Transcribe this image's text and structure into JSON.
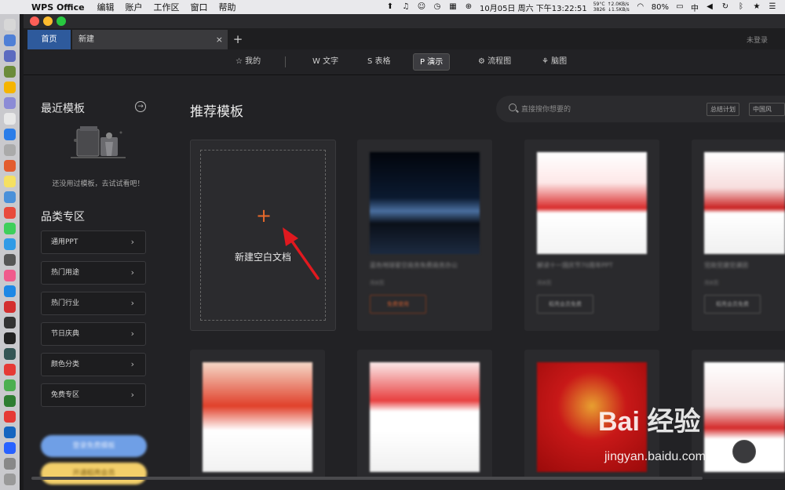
{
  "menubar": {
    "app_name": "WPS Office",
    "menus": [
      "编辑",
      "账户",
      "工作区",
      "窗口",
      "帮助"
    ],
    "temp": "59°C",
    "fan": "3826",
    "net_up": "↑2.0KB/s",
    "net_down": "↓1.5KB/s",
    "datetime": "10月05日 周六 下午13:22:51",
    "battery": "80%",
    "input": "中"
  },
  "tabs": {
    "home": "首页",
    "new": "新建",
    "close": "×",
    "add": "+",
    "login": "未登录"
  },
  "topnav": [
    {
      "label": "☆ 我的",
      "icon": "star-icon"
    },
    {
      "label": "W 文字",
      "icon": "writer-icon"
    },
    {
      "label": "S 表格",
      "icon": "sheet-icon"
    },
    {
      "label": "P 演示",
      "icon": "presentation-icon",
      "active": true
    },
    {
      "label": "⚙ 流程图",
      "icon": "flowchart-icon"
    },
    {
      "label": "⚘ 脑图",
      "icon": "mindmap-icon"
    }
  ],
  "sidebar": {
    "recent_title": "最近模板",
    "recent_arrow": "→",
    "empty_text": "还没用过模板，去试试看吧！",
    "category_title": "品类专区",
    "categories": [
      "通用PPT",
      "热门用途",
      "热门行业",
      "节日庆典",
      "颜色分类",
      "免费专区"
    ],
    "chevron": "›",
    "pill1": "登录免费模板",
    "pill2": "开通稻壳会员"
  },
  "main": {
    "title": "推荐模板",
    "search_placeholder": "直接搜你想要的",
    "search_tags": [
      "总结计划",
      "中国风"
    ],
    "blank_plus": "+",
    "blank_label": "新建空白文档"
  },
  "templates_row1": [
    {
      "caption": "蓝色地球星空商务免费商务办公",
      "pages": "共8页",
      "button": "免费使用"
    },
    {
      "caption": "解读十一国庆节70周年PPT",
      "pages": "共8页",
      "button": "稻壳会员免费"
    },
    {
      "caption": "党政党建党课团",
      "pages": "共8页",
      "button": "稻壳会员免费"
    }
  ],
  "templates_row2": [
    {
      "caption": "",
      "pages": "",
      "button": ""
    },
    {
      "caption": "",
      "pages": "",
      "button": ""
    },
    {
      "caption": "",
      "pages": "",
      "button": ""
    },
    {
      "caption": "",
      "pages": "",
      "button": ""
    }
  ],
  "watermark": {
    "brand": "Bai 经验",
    "url": "jingyan.baidu.com"
  },
  "colors": {
    "accent_orange": "#e8692a",
    "tab_blue": "#2e5a9c",
    "arrow_red": "#e0191f"
  }
}
